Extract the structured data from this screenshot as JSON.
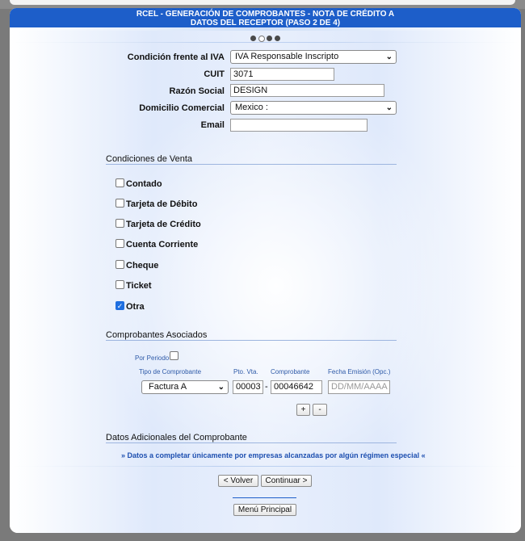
{
  "header": {
    "line1": "RCEL - GENERACIÓN DE COMPROBANTES - NOTA DE CRÉDITO A",
    "line2": "DATOS DEL RECEPTOR (PASO 2 DE 4)"
  },
  "steps": {
    "total": 4,
    "current": 2
  },
  "receptor": {
    "condicion_label": "Condición frente al IVA",
    "condicion_value": "IVA Responsable Inscripto",
    "cuit_label": "CUIT",
    "cuit_value": "3071",
    "razon_label": "Razón Social",
    "razon_value": "DESIGN",
    "domicilio_label": "Domicilio Comercial",
    "domicilio_value": "Mexico :",
    "email_label": "Email",
    "email_value": ""
  },
  "condiciones": {
    "title": "Condiciones de Venta",
    "items": [
      {
        "label": "Contado",
        "checked": false
      },
      {
        "label": "Tarjeta de Débito",
        "checked": false
      },
      {
        "label": "Tarjeta de Crédito",
        "checked": false
      },
      {
        "label": "Cuenta Corriente",
        "checked": false
      },
      {
        "label": "Cheque",
        "checked": false
      },
      {
        "label": "Ticket",
        "checked": false
      },
      {
        "label": "Otra",
        "checked": true
      }
    ]
  },
  "asociados": {
    "title": "Comprobantes Asociados",
    "por_periodo_label": "Por Periodo",
    "col_tipo": "Tipo de Comprobante",
    "col_pto": "Pto. Vta.",
    "col_comp": "Comprobante",
    "col_fecha": "Fecha Emisión (Opc.)",
    "tipo_value": "Factura A",
    "pto_value": "00003",
    "dash": "-",
    "comp_value": "00046642",
    "fecha_placeholder": "DD/MM/AAAA",
    "add_label": "+",
    "remove_label": "-"
  },
  "adicionales": {
    "title": "Datos Adicionales del Comprobante",
    "note": "» Datos a completar únicamente por empresas alcanzadas por algún régimen especial «"
  },
  "actions": {
    "volver": "< Volver",
    "continuar": "Continuar >",
    "menu": "Menú Principal"
  }
}
